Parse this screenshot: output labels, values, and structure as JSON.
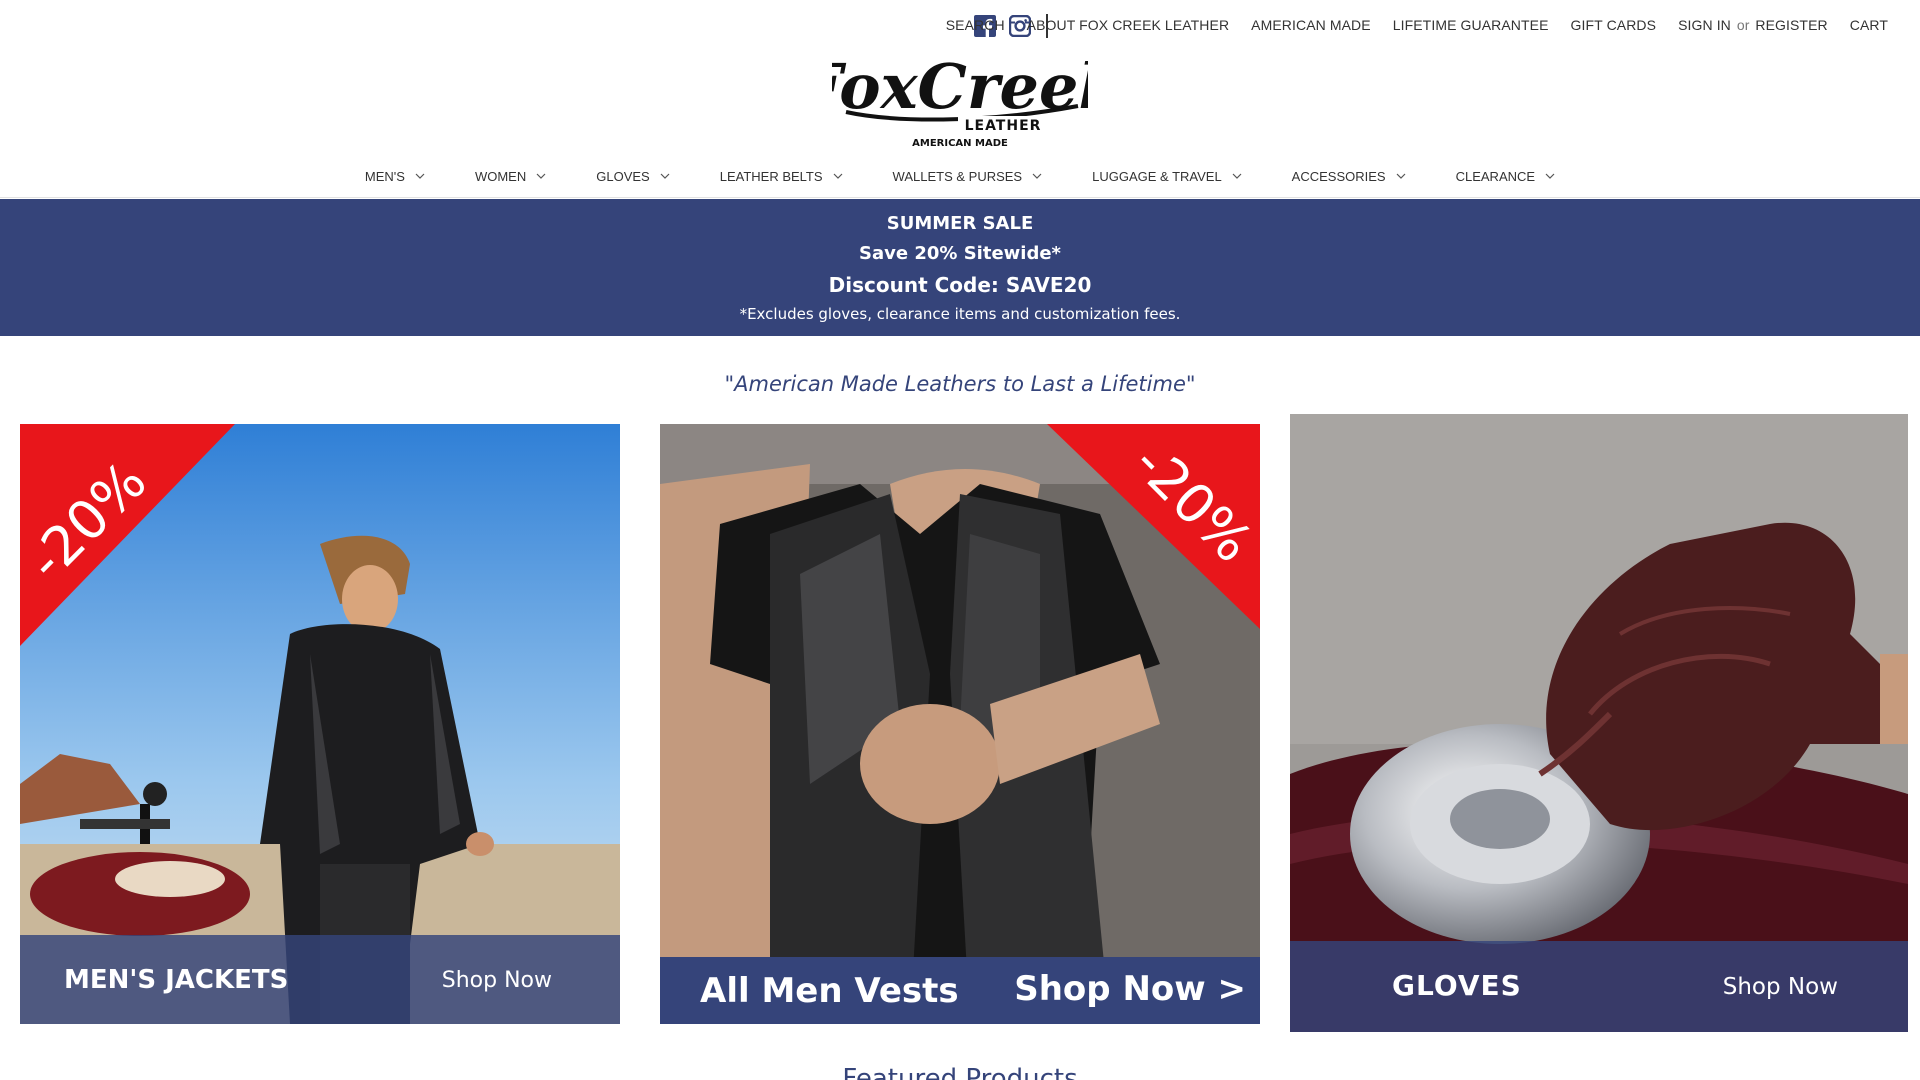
{
  "social": {
    "icons": [
      "facebook-icon",
      "instagram-icon"
    ]
  },
  "utility_links": {
    "search": "SEARCH",
    "about": "ABOUT FOX CREEK LEATHER",
    "american": "AMERICAN MADE",
    "guarantee": "LIFETIME GUARANTEE",
    "gift": "GIFT CARDS",
    "signin": "SIGN IN",
    "or": "or",
    "register": "REGISTER",
    "cart": "CART"
  },
  "logo": {
    "brand": "FoxCreek",
    "sub": "LEATHER",
    "tag": "AMERICAN MADE"
  },
  "nav": {
    "items": [
      "MEN'S",
      "WOMEN",
      "GLOVES",
      "LEATHER BELTS",
      "WALLETS & PURSES",
      "LUGGAGE & TRAVEL",
      "ACCESSORIES",
      "CLEARANCE"
    ]
  },
  "sale": {
    "line1": "SUMMER SALE",
    "line2": "Save 20% Sitewide*",
    "line3": "Discount Code: SAVE20",
    "line4": "*Excludes gloves, clearance items and customization fees."
  },
  "tagline": "\"American Made Leathers to Last a Lifetime\"",
  "banners": [
    {
      "badge": "-20%",
      "title": "MEN'S JACKETS",
      "shop": "Shop Now"
    },
    {
      "badge": "-20%",
      "title": "All Men Vests",
      "shop": "Shop Now >"
    },
    {
      "title": "GLOVES",
      "shop": "Shop Now"
    }
  ],
  "featured": "Featured Products",
  "colors": {
    "navy": "#35447a",
    "sale_red": "#e8161b"
  }
}
